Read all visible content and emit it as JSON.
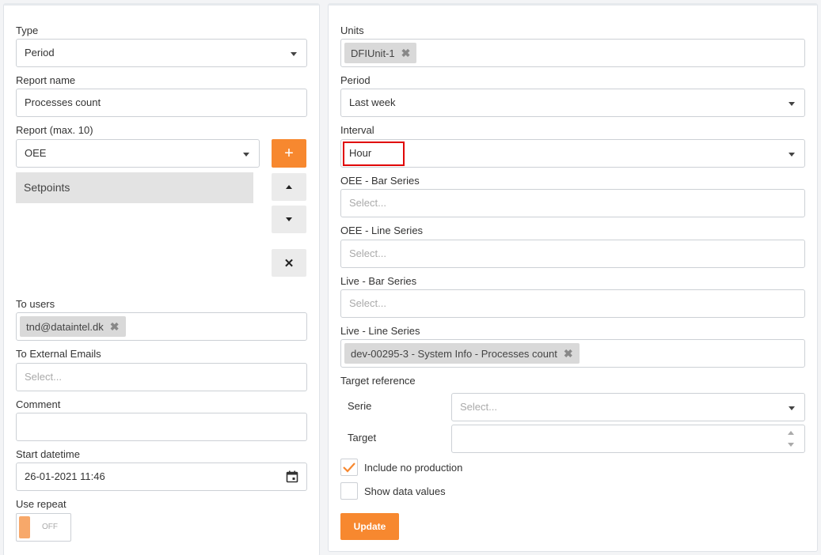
{
  "left": {
    "type": {
      "label": "Type",
      "value": "Period"
    },
    "report_name": {
      "label": "Report name",
      "value": "Processes count"
    },
    "report": {
      "label": "Report (max. 10)",
      "value": "OEE",
      "add_label": "+",
      "items": [
        "Setpoints"
      ],
      "remove_label": "✕"
    },
    "to_users": {
      "label": "To users",
      "tags": [
        "tnd@dataintel.dk"
      ]
    },
    "external_emails": {
      "label": "To External Emails",
      "placeholder": "Select..."
    },
    "comment": {
      "label": "Comment",
      "value": ""
    },
    "start_datetime": {
      "label": "Start datetime",
      "value": "26-01-2021 11:46"
    },
    "use_repeat": {
      "label": "Use repeat",
      "toggle_text": "OFF"
    }
  },
  "right": {
    "units": {
      "label": "Units",
      "tags": [
        "DFIUnit-1"
      ]
    },
    "period": {
      "label": "Period",
      "value": "Last week"
    },
    "interval": {
      "label": "Interval",
      "value": "Hour"
    },
    "oee_bar": {
      "label": "OEE - Bar Series",
      "placeholder": "Select..."
    },
    "oee_line": {
      "label": "OEE - Line Series",
      "placeholder": "Select..."
    },
    "live_bar": {
      "label": "Live - Bar Series",
      "placeholder": "Select..."
    },
    "live_line": {
      "label": "Live - Line Series",
      "tags": [
        "dev-00295-3 - System Info - Processes count"
      ]
    },
    "target_reference": {
      "label": "Target reference",
      "serie_label": "Serie",
      "serie_placeholder": "Select...",
      "target_label": "Target",
      "target_value": ""
    },
    "include_no_production": {
      "label": "Include no production",
      "checked": true
    },
    "show_data_values": {
      "label": "Show data values",
      "checked": false
    },
    "update_label": "Update"
  },
  "colors": {
    "accent": "#f7882f",
    "highlight": "#e00000"
  }
}
